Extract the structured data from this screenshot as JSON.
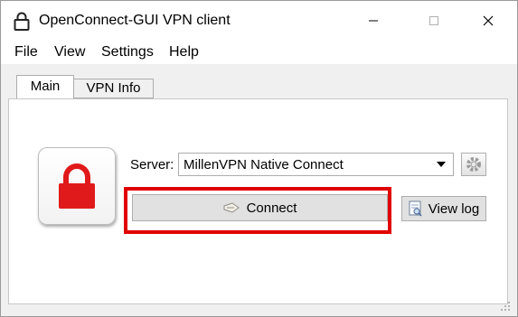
{
  "window": {
    "title": "OpenConnect-GUI VPN client"
  },
  "menu": {
    "items": [
      "File",
      "View",
      "Settings",
      "Help"
    ]
  },
  "tabs": [
    {
      "label": "Main",
      "active": true
    },
    {
      "label": "VPN Info",
      "active": false
    }
  ],
  "main": {
    "server_label": "Server:",
    "server_value": "MillenVPN Native Connect",
    "connect_label": "Connect",
    "view_log_label": "View log",
    "status_icon": "lock-icon",
    "lock_color": "#e01a1a",
    "highlight_color": "#e00000"
  }
}
